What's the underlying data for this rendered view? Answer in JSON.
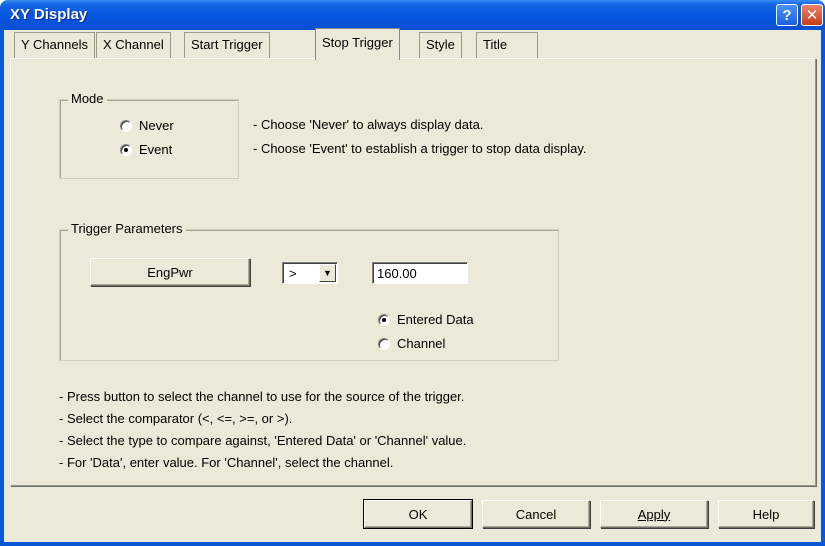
{
  "window": {
    "title": "XY Display"
  },
  "titlebar": {
    "help_glyph": "?",
    "close_glyph": "✕"
  },
  "tabs": [
    {
      "label": "Y Channels"
    },
    {
      "label": "X Channel"
    },
    {
      "label": "Start Trigger"
    },
    {
      "label": "Stop Trigger",
      "active": true
    },
    {
      "label": "Style"
    },
    {
      "label": "Title"
    }
  ],
  "mode": {
    "group_label": "Mode",
    "options": [
      {
        "label": "Never",
        "checked": false
      },
      {
        "label": "Event",
        "checked": true
      }
    ],
    "hints": [
      "- Choose 'Never' to always display data.",
      "- Choose 'Event' to establish a trigger to stop data display."
    ]
  },
  "trigger": {
    "group_label": "Trigger Parameters",
    "channel_button": "EngPwr",
    "comparator": ">",
    "value": "160.00",
    "source_options": [
      {
        "label": "Entered Data",
        "checked": true
      },
      {
        "label": "Channel",
        "checked": false
      }
    ]
  },
  "instructions": [
    "- Press button to select the channel to use for the source of the trigger.",
    "- Select the comparator (<, <=, >=, or >).",
    "- Select the type to compare against, 'Entered Data' or 'Channel' value.",
    "- For 'Data', enter value.  For 'Channel', select the channel."
  ],
  "footer": {
    "ok": "OK",
    "cancel": "Cancel",
    "apply": "Apply",
    "help": "Help"
  },
  "colors": {
    "titlebar": "#0554e0",
    "dialog_bg": "#ece9d8",
    "close_button": "#c83b18"
  }
}
